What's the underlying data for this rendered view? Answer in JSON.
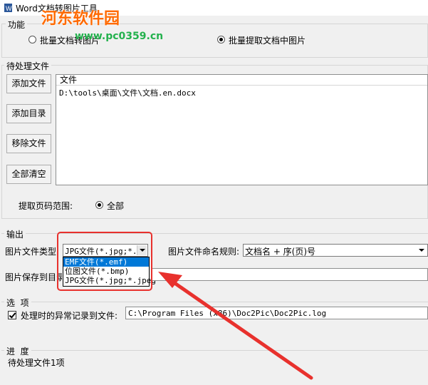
{
  "window": {
    "title": "Word文档转图片工具",
    "watermark_text": "河东软件园",
    "watermark_url": "www.pc0359.cn"
  },
  "function_group": {
    "label": "功能",
    "options": [
      {
        "label": "批量文档转图片",
        "selected": false
      },
      {
        "label": "批量提取文档中图片",
        "selected": true
      }
    ]
  },
  "pending_files": {
    "label": "待处理文件",
    "buttons": {
      "add_file": "添加文件",
      "add_dir": "添加目录",
      "remove_file": "移除文件",
      "clear_all": "全部清空"
    },
    "list_header": "文件",
    "files": [
      "D:\\tools\\桌面\\文件\\文档.en.docx"
    ],
    "page_range_label": "提取页码范围:",
    "page_range_option": "全部"
  },
  "output": {
    "label": "输出",
    "image_type_label": "图片文件类型:",
    "image_type_value": "JPG文件(*.jpg;*.",
    "image_type_options": [
      {
        "label": "EMF文件(*.emf)",
        "selected": true
      },
      {
        "label": "位图文件(*.bmp)",
        "selected": false
      },
      {
        "label": "JPG文件(*.jpg;*.jpeg",
        "selected": false
      }
    ],
    "naming_rule_label": "图片文件命名规则:",
    "naming_rule_value": "文档名 + 序(页)号",
    "save_dir_label": "图片保存到目录",
    "save_dir_value": ""
  },
  "options": {
    "label": "选  项",
    "log_errors_label": "处理时的异常记录到文件:",
    "log_errors_checked": true,
    "log_path": "C:\\Program Files (x86)\\Doc2Pic\\Doc2Pic.log"
  },
  "progress": {
    "label": "进  度",
    "status": "待处理文件1项"
  },
  "colors": {
    "annotation_red": "#e8312d",
    "selection_blue": "#0078d7",
    "watermark_orange": "#ff6a00",
    "watermark_green": "#23b14d"
  }
}
